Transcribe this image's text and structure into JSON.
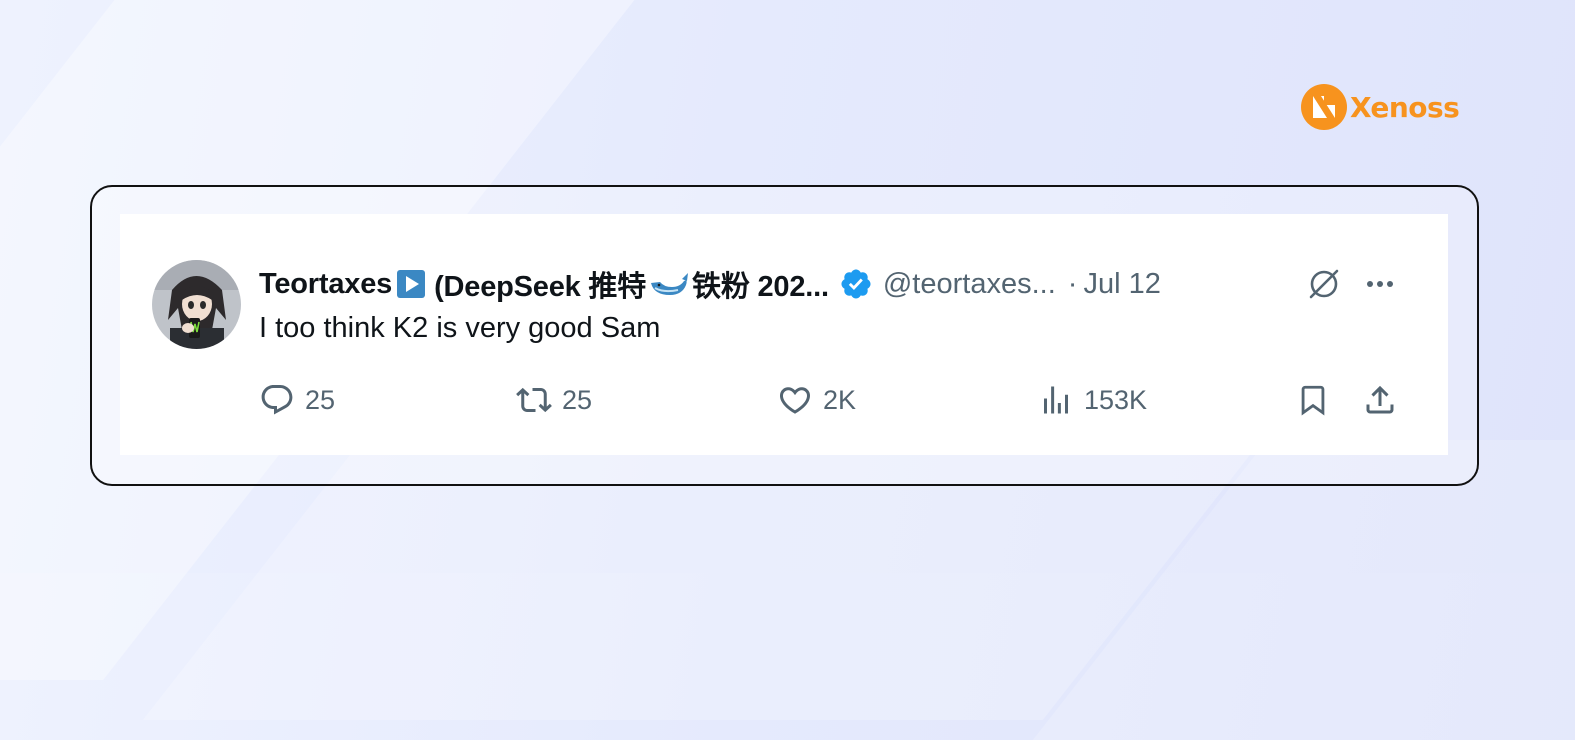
{
  "brand": {
    "name": "Xenoss",
    "color": "#f7931e",
    "icon": "xenoss-logo-icon"
  },
  "tweet": {
    "author": {
      "name_part1": "Teortaxes",
      "name_part2": "(DeepSeek 推特",
      "name_part3": "铁粉 202...",
      "emojis": [
        "play-button-emoji-icon",
        "whale-emoji-icon"
      ],
      "verified": true,
      "handle": "@teortaxes...",
      "avatar": "avatar-image"
    },
    "separator": "·",
    "date": "Jul 12",
    "text": "I too think K2 is very good Sam",
    "header_icons": [
      "grok-icon",
      "more-icon"
    ],
    "actions": {
      "replies": "25",
      "reposts": "25",
      "likes": "2K",
      "views": "153K"
    },
    "colors": {
      "text": "#0f1419",
      "muted": "#536471",
      "verified": "#1d9bf0"
    }
  }
}
